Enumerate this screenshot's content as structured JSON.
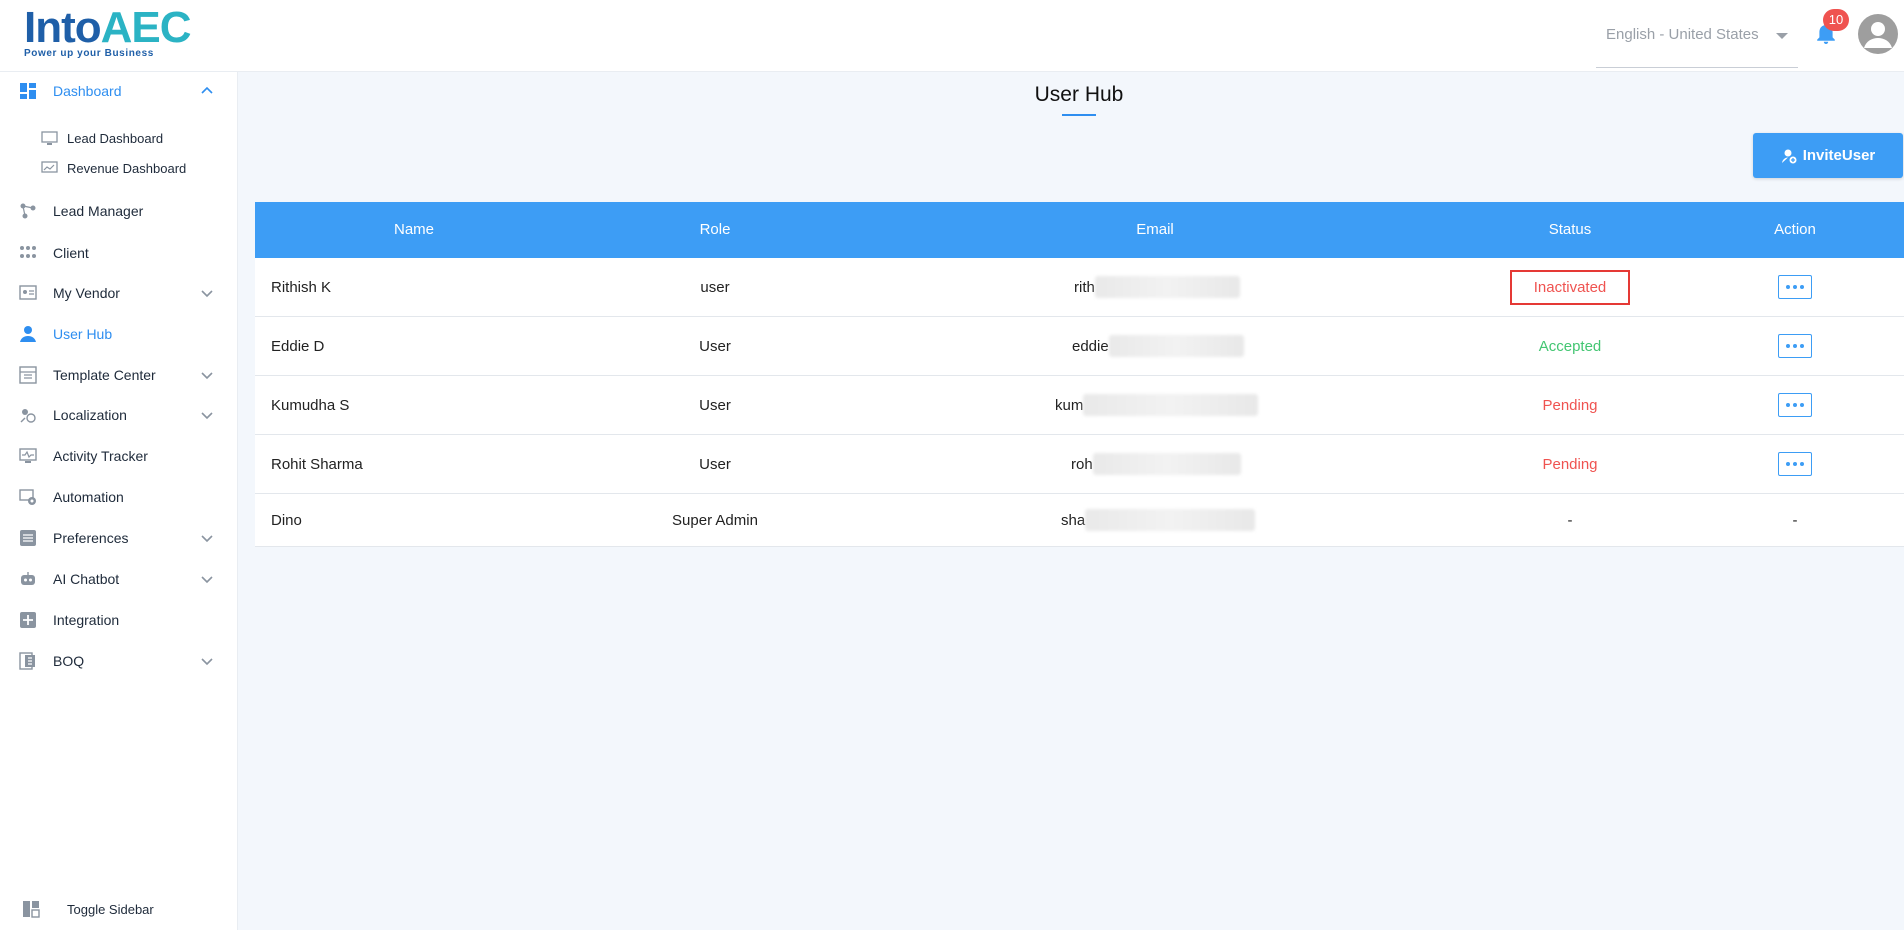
{
  "header": {
    "logo_main": "Into",
    "logo_accent": "AEC",
    "logo_tagline": "Power up your Business",
    "language": "English - United States",
    "notification_count": "10"
  },
  "sidebar": {
    "items": [
      {
        "label": "Dashboard"
      },
      {
        "label": "Lead Dashboard"
      },
      {
        "label": "Revenue Dashboard"
      },
      {
        "label": "Lead Manager"
      },
      {
        "label": "Client"
      },
      {
        "label": "My Vendor"
      },
      {
        "label": "User Hub"
      },
      {
        "label": "Template Center"
      },
      {
        "label": "Localization"
      },
      {
        "label": "Activity Tracker"
      },
      {
        "label": "Automation"
      },
      {
        "label": "Preferences"
      },
      {
        "label": "AI Chatbot"
      },
      {
        "label": "Integration"
      },
      {
        "label": "BOQ"
      }
    ],
    "toggle_label": "Toggle Sidebar"
  },
  "main": {
    "title": "User Hub",
    "invite_label": "InviteUser"
  },
  "table": {
    "columns": [
      "Name",
      "Role",
      "Email",
      "Status",
      "Action"
    ],
    "rows": [
      {
        "name": "Rithish K",
        "role": "user",
        "email": "rith",
        "status": "Inactivated"
      },
      {
        "name": "Eddie D",
        "role": "User",
        "email": "eddie",
        "status": "Accepted"
      },
      {
        "name": "Kumudha S",
        "role": "User",
        "email": "kum",
        "status": "Pending"
      },
      {
        "name": "Rohit  Sharma",
        "role": "User",
        "email": "roh",
        "status": "Pending"
      },
      {
        "name": "Dino",
        "role": "Super Admin",
        "email": "sha",
        "status": "-",
        "action": "-"
      }
    ]
  },
  "colors": {
    "primary": "#3d9df5",
    "active_nav": "#2e8ef0",
    "danger": "#ef5350",
    "success": "#43c672"
  }
}
